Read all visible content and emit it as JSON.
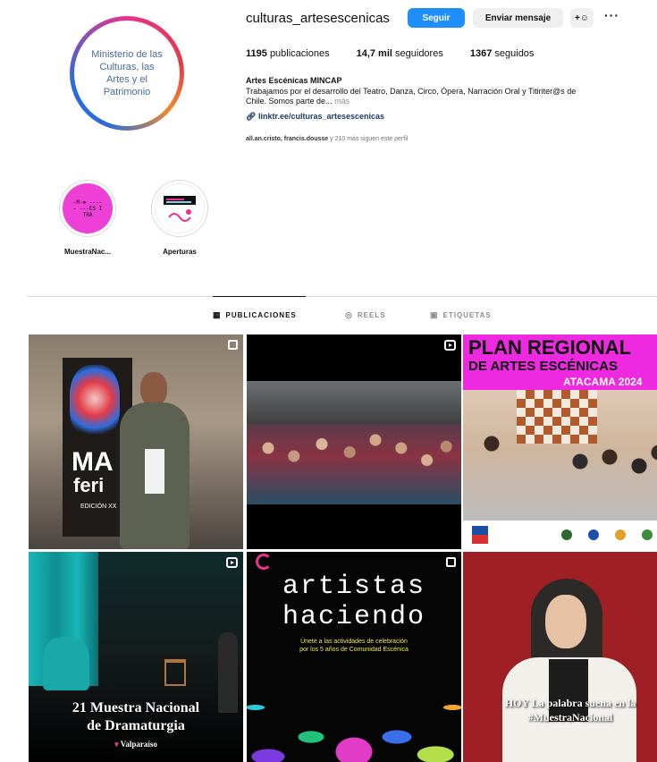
{
  "profile": {
    "avatar_text": "Ministerio de las Culturas, las Artes y el Patrimonio",
    "username": "culturas_artesescenicas",
    "follow_label": "Seguir",
    "message_label": "Enviar mensaje",
    "add_icon": "+☺",
    "more_icon": "···"
  },
  "stats": {
    "posts_count": "1195",
    "posts_label": "publicaciones",
    "followers_count": "14,7 mil",
    "followers_label": "seguidores",
    "following_count": "1367",
    "following_label": "seguidos"
  },
  "bio": {
    "name": "Artes Escénicas MINCAP",
    "line1": "Trabajamos por el desarrollo del Teatro, Danza, Circo, Ópera, Narración Oral y Titiriter@s de",
    "line2": "Chile. Somos parte de...",
    "more": "más",
    "link": "linktr.ee/culturas_artesescenicas",
    "followed_by_names": "all.an.cristo, francis.dousse",
    "followed_by_rest": "y 210 más siguen este perfil"
  },
  "highlights": [
    {
      "label": "MuestraNac...",
      "art_text": "-M-● ----- ---ES ITRA"
    },
    {
      "label": "Aperturas"
    }
  ],
  "tabs": [
    {
      "label": "PUBLICACIONES",
      "icon": "▦",
      "active": true
    },
    {
      "label": "REELS",
      "icon": "◎",
      "active": false
    },
    {
      "label": "ETIQUETAS",
      "icon": "▣",
      "active": false
    }
  ],
  "posts": {
    "p1": {
      "poster_big": "MA",
      "poster_big2": "feri",
      "poster_small": "EDICIÓN XX"
    },
    "p3": {
      "title1": "PLAN REGIONAL",
      "title2": "DE ARTES ESCÉNICAS",
      "title3": "ATACAMA 2024"
    },
    "p4": {
      "cap1": "21 Muestra Nacional",
      "cap2": "de Dramaturgia",
      "cap3": "Valparaíso"
    },
    "p5": {
      "title1": "artistas",
      "title2": "haciendo",
      "sub1": "Únete a las actividades de celebración",
      "sub2": "por los 5 años de Comunidad Escénica"
    },
    "p6": {
      "cap1": "HOY La palabra suena en la",
      "cap2": "#MuestraNacional"
    }
  },
  "colors": {
    "follow_button": "#1f8fff",
    "plan_band": "#ee2ae0",
    "highlight_pink": "#ee3fd7"
  }
}
